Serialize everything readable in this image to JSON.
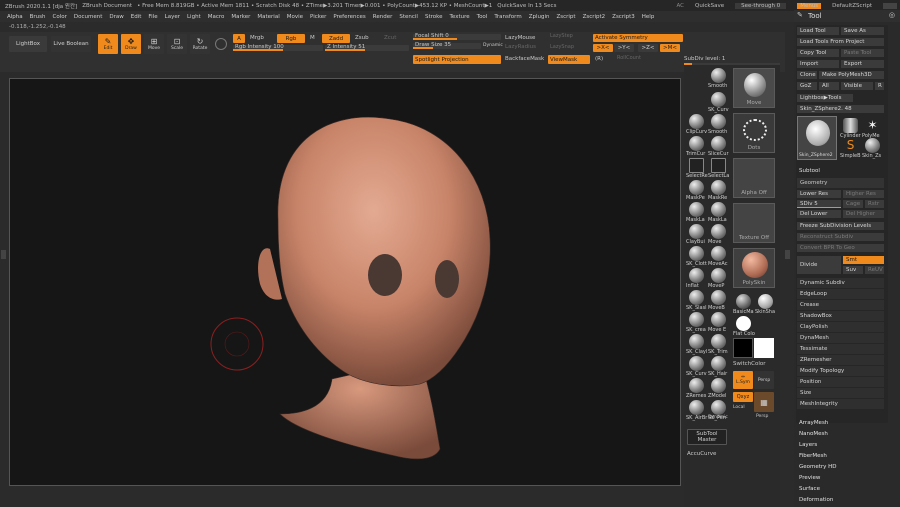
{
  "titlebar": {
    "app": "ZBrush 2020.1.1 [dja 윈칸]",
    "document": "ZBrush Document",
    "freemem": "• Free Mem 8.819GB • Active Mem 1811 • Scratch Disk 48 • ZTime▶3.201 Timer▶0.001 • PolyCount▶453.12 KP • MeshCount▶1",
    "quicksave": "QuickSave In 13 Secs",
    "ac": "AC",
    "quicksave_btn": "QuickSave",
    "seethrough": "See-through  0",
    "menus": "Menus",
    "script": "DefaultZScript"
  },
  "menus": [
    "Alpha",
    "Brush",
    "Color",
    "Document",
    "Draw",
    "Edit",
    "File",
    "Layer",
    "Light",
    "Macro",
    "Marker",
    "Material",
    "Movie",
    "Picker",
    "Preferences",
    "Render",
    "Stencil",
    "Stroke",
    "Texture",
    "Tool",
    "Transform",
    "Zplugin",
    "Zscript",
    "Zscript2",
    "Zscript3",
    "Help"
  ],
  "coords": "-0.118,-1.252,-0.148",
  "shelf": {
    "lightbox": "LightBox",
    "live_boolean": "Live Boolean",
    "edit": "Edit",
    "draw": "Draw",
    "move": "Move",
    "scale": "Scale",
    "rotate": "Rotate",
    "a": "A",
    "mrgb": "Mrgb",
    "rgb": "Rgb",
    "m": "M",
    "zadd": "Zadd",
    "zsub": "Zsub",
    "zcut": "Zcut",
    "rgb_intensity": "Rgb Intensity 100",
    "z_intensity": "Z Intensity 51",
    "focal_shift": "Focal Shift 0",
    "draw_size": "Draw Size 35",
    "dynamic": "Dynamic",
    "lazymouse": "LazyMouse",
    "lazyradius": "LazyRadius",
    "lazystep": "LazyStep",
    "lazysnap": "LazySnap",
    "activate_symmetry": "Activate Symmetry",
    "x": ">X<",
    "y": ">Y<",
    "z": ">Z<",
    "m2": ">M<",
    "spotlight": "Spotlight Projection",
    "backfacemask": "BackfaceMask",
    "viewmask": "ViewMask",
    "r": "(R)",
    "rollcount": "RollCount",
    "subdiv": "SubDiv level: 1"
  },
  "sidebar": {
    "brushes": [
      "Smooth",
      "SK_Curv",
      "ClipCurv",
      "Smooth",
      "TrimCur",
      "SliceCur",
      "SelectRe",
      "SelectLa",
      "MaskPe",
      "MaskRe",
      "MaskLa",
      "MaskLa",
      "ClayBui",
      "Move",
      "SK_Clott",
      "MoveAc",
      "Inflat",
      "MoveP",
      "SK_Slasl",
      "MoveB",
      "SK_crea",
      "Move E",
      "SK_Clayl",
      "SK_Trim",
      "SK_Curv",
      "SK_Hair",
      "ZRemes",
      "ZModel",
      "SK_AirBr",
      "SK_Pen"
    ],
    "tiles": {
      "move": "Move",
      "dots": "Dots",
      "alpha_off": "Alpha Off",
      "texture_off": "Texture Off",
      "polyskin": "PolySkin",
      "switchcolor": "SwitchColor",
      "basicmat": "BasicMa",
      "skinshade": "SkinSha",
      "flatcolor": "Flat Colo",
      "lsym": "L.Sym",
      "persp": "Persp",
      "floor": "Floor",
      "qxyz": "Qxyz",
      "persp2": "Persp",
      "local": "Local",
      "dynamic": "Dynamic",
      "subtool_master": "SubTool Master",
      "accucurve": "AccuCurve"
    }
  },
  "rpanel": {
    "tool_title": "Tool",
    "load_tool": "Load Tool",
    "save_as": "Save As",
    "load_from_project": "Load Tools From Project",
    "copy_tool": "Copy Tool",
    "paste_tool": "Paste Tool",
    "import": "Import",
    "export": "Export",
    "clone": "Clone",
    "make_polymesh": "Make PolyMesh3D",
    "goz": "GoZ",
    "all": "All",
    "visible": "Visible",
    "r": "R",
    "lightbox_tools": "Lightbox▶Tools",
    "skin_name": "Skin_ZSphere2. 48",
    "thumbs": [
      "Skin_ZSphere2",
      "Cylinder",
      "PolyMe",
      "SimpleB",
      "Skin_Zs"
    ],
    "subtool": "Subtool",
    "geometry": "Geometry",
    "lower_res": "Lower Res",
    "higher_res": "Higher Res",
    "sdiv": "SDiv 5",
    "cage": "Cage",
    "rstr": "Rstr",
    "del_lower": "Del Lower",
    "del_higher": "Del Higher",
    "freeze": "Freeze SubDivision Levels",
    "reconstruct": "Reconstruct Subdiv",
    "convert_bpr": "Convert BPR To Geo",
    "divide": "Divide",
    "smt": "Smt",
    "suv": "Suv",
    "reuv": "ReUV",
    "items": [
      "Dynamic Subdiv",
      "EdgeLoop",
      "Crease",
      "ShadowBox",
      "ClayPolish",
      "DynaMesh",
      "Tessimate",
      "ZRemesher",
      "Modify Topology",
      "Position",
      "Size",
      "MeshIntegrity"
    ],
    "sections": [
      "ArrayMesh",
      "NanoMesh",
      "Layers",
      "FiberMesh",
      "Geometry HD",
      "Preview",
      "Surface",
      "Deformation"
    ]
  }
}
